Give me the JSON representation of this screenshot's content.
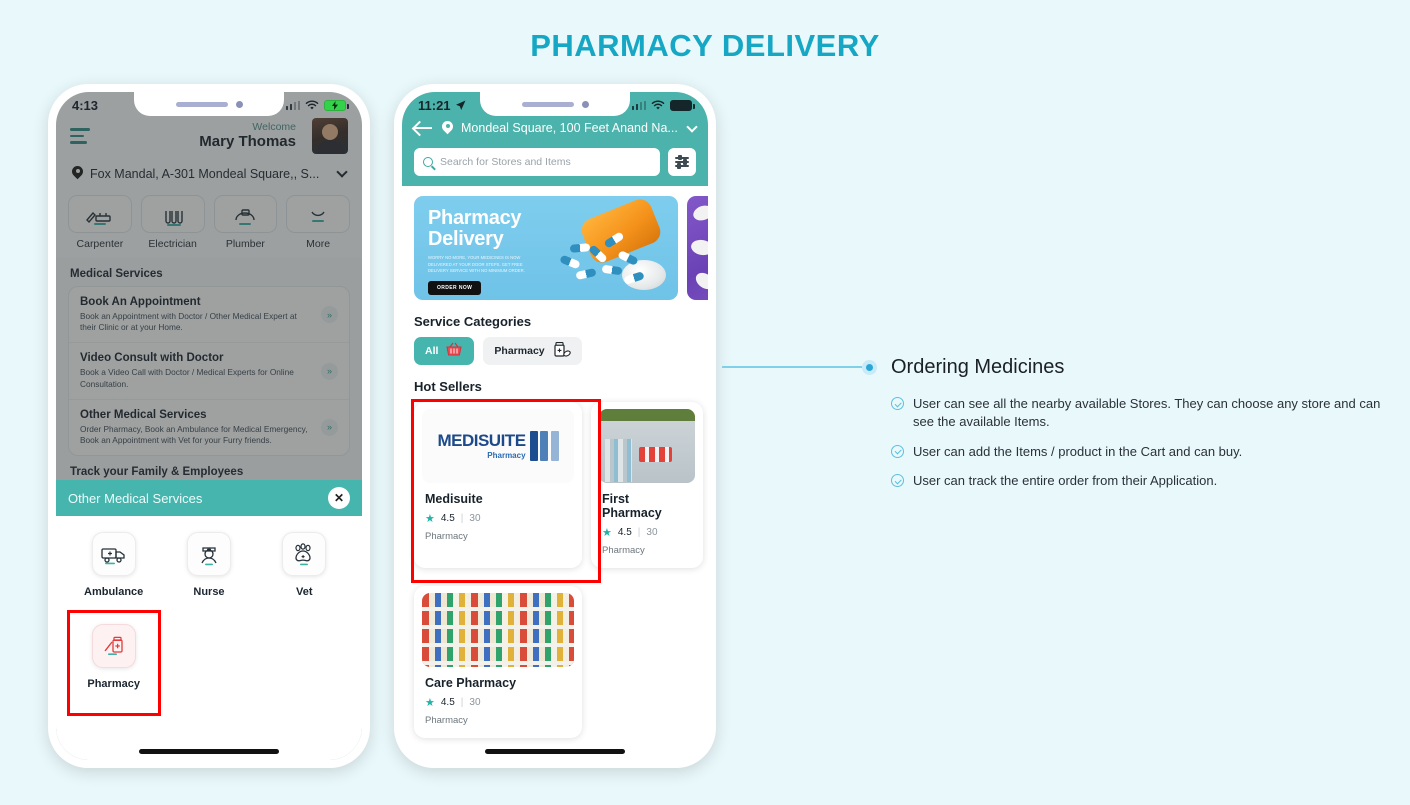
{
  "page": {
    "title": "PHARMACY DELIVERY",
    "accent": "#16a7c4",
    "background": "#e9f8fb"
  },
  "phone1": {
    "status": {
      "time": "4:13",
      "wifi_icon": "wifi-icon",
      "battery_icon": "battery-charging-icon"
    },
    "header": {
      "menu_icon": "hamburger-menu-icon",
      "welcome_label": "Welcome",
      "user_name": "Mary Thomas",
      "avatar": "user-avatar",
      "location_icon": "location-pin-icon",
      "address": "Fox Mandal, A-301 Mondeal Square,, S...",
      "dropdown_icon": "chevron-down-icon"
    },
    "services": [
      {
        "label": "Carpenter",
        "icon": "carpenter-icon",
        "glyph": "⚒"
      },
      {
        "label": "Electrician",
        "icon": "electrician-icon",
        "glyph": "⚡"
      },
      {
        "label": "Plumber",
        "icon": "plumber-icon",
        "glyph": "⚙"
      },
      {
        "label": "More",
        "icon": "more-icon",
        "glyph": "⋯"
      }
    ],
    "medical_section_title": "Medical Services",
    "medical_items": [
      {
        "title": "Book An Appointment",
        "subtitle": "Book an Appointment with Doctor / Other Medical Expert at their Clinic or at your Home.",
        "arrow": "»"
      },
      {
        "title": "Video Consult with Doctor",
        "subtitle": "Book a Video Call with Doctor / Medical Experts for Online Consultation.",
        "arrow": "»"
      },
      {
        "title": "Other Medical Services",
        "subtitle": "Order Pharmacy, Book an Ambulance for Medical Emergency, Book an Appointment with Vet for your Furry friends.",
        "arrow": "»"
      }
    ],
    "track_section_title": "Track your Family & Employees",
    "sheet": {
      "title": "Other Medical Services",
      "close_icon": "close-icon",
      "close_glyph": "✕",
      "items": [
        {
          "label": "Ambulance",
          "icon": "ambulance-icon",
          "glyph": "🚑"
        },
        {
          "label": "Nurse",
          "icon": "nurse-icon",
          "glyph": "👩‍⚕️"
        },
        {
          "label": "Vet",
          "icon": "vet-paw-icon",
          "glyph": "🐾"
        },
        {
          "label": "Pharmacy",
          "icon": "pharmacy-icon",
          "glyph": "💊",
          "highlighted": true
        }
      ]
    }
  },
  "phone2": {
    "status": {
      "time": "11:21",
      "location_arrow_icon": "navigation-arrow-icon",
      "wifi_icon": "wifi-icon",
      "battery_icon": "battery-full-icon"
    },
    "header": {
      "back_icon": "back-arrow-icon",
      "location_icon": "location-pin-icon",
      "address": "Mondeal Square, 100 Feet Anand Na...",
      "dropdown_icon": "chevron-down-icon",
      "search_placeholder": "Search for Stores and Items",
      "search_icon": "search-icon",
      "filter_icon": "filter-sliders-icon"
    },
    "banner": {
      "title_line1": "Pharmacy",
      "title_line2": "Delivery",
      "subtitle": "WORRY NO MORE, YOUR MEDICINES IS NOW DELIVERED AT YOUR DOOR STEPS. GET FREE DELIVERY SERVICE WITH NO MINIMUM ORDER.",
      "cta": "ORDER NOW"
    },
    "service_categories_title": "Service Categories",
    "chips": [
      {
        "label": "All",
        "icon": "basket-icon",
        "glyph": "🧺",
        "active": true
      },
      {
        "label": "Pharmacy",
        "icon": "pharmacy-bottle-icon",
        "glyph": "💊",
        "active": false
      }
    ],
    "hot_sellers_title": "Hot Sellers",
    "stores": [
      {
        "name": "Medisuite",
        "rating": "4.5",
        "reviews": "30",
        "category": "Pharmacy",
        "logo_main": "MEDISUITE",
        "logo_sub": "Pharmacy",
        "highlighted": true
      },
      {
        "name": "First Pharmacy",
        "rating": "4.5",
        "reviews": "30",
        "category": "Pharmacy",
        "highlighted": false
      },
      {
        "name": "Care Pharmacy",
        "rating": "4.5",
        "reviews": "30",
        "category": "Pharmacy",
        "highlighted": false
      }
    ],
    "star_icon": "star-icon",
    "star_glyph": "★",
    "rating_separator": "|"
  },
  "annotation": {
    "marker_icon": "bullet-dot-icon",
    "title": "Ordering Medicines",
    "bullets": [
      "User can see all the nearby available Stores. They can choose any store and can see the available Items.",
      "User can add the Items / product in the Cart and can buy.",
      "User can track the entire order from their Application."
    ]
  }
}
